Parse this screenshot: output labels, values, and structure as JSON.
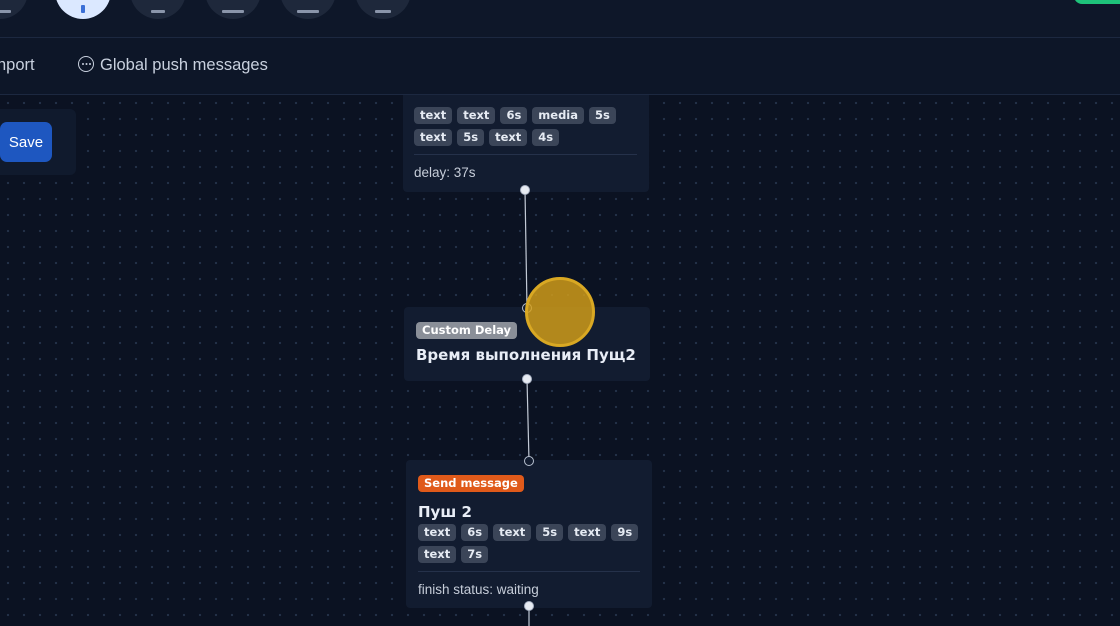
{
  "topbar": {
    "icons": [
      "menu-icon",
      "cursor-tool-icon",
      "grid-icon",
      "window-icon",
      "panel-icon",
      "calendar-icon"
    ]
  },
  "subnav": {
    "import_label": "nport",
    "global_push_label": "Global push messages"
  },
  "toolbar": {
    "save_label": "Save"
  },
  "nodes": {
    "push1": {
      "chips_row1": [
        "text",
        "text",
        "6s",
        "media",
        "5s"
      ],
      "chips_row2": [
        "text",
        "5s",
        "text",
        "4s"
      ],
      "footer": "delay: 37s"
    },
    "custom_delay": {
      "badge": "Custom Delay",
      "title": "Время выполнения Пущ2"
    },
    "push2": {
      "badge": "Send message",
      "title": "Пуш 2",
      "chips_row1": [
        "text",
        "6s",
        "text",
        "5s",
        "text",
        "9s"
      ],
      "chips_row2": [
        "text",
        "7s"
      ],
      "footer": "finish status: waiting"
    }
  },
  "colors": {
    "background": "#0b1222",
    "accent": "#1e57c0",
    "custom_delay_badge": "#8a8f98",
    "send_message_badge": "#e05a1a",
    "cursor_highlight": "#d9a823"
  }
}
